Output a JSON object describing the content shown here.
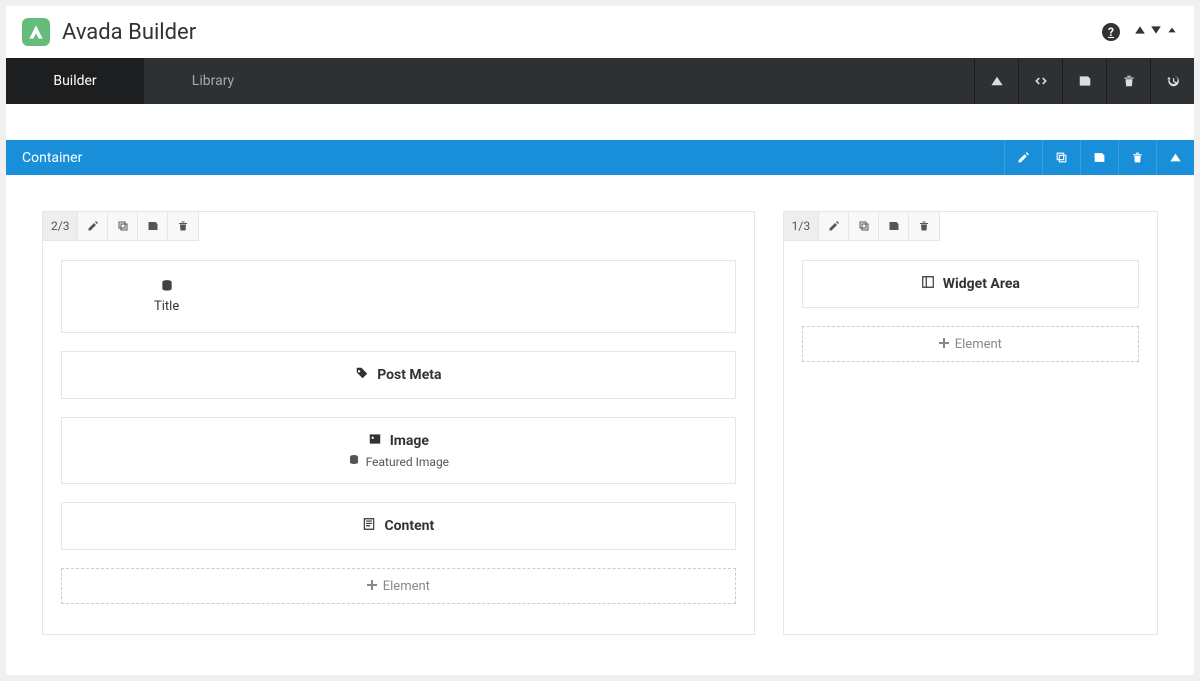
{
  "header": {
    "title": "Avada Builder"
  },
  "tabs": {
    "builder": "Builder",
    "library": "Library"
  },
  "container": {
    "title": "Container"
  },
  "columns": {
    "left": {
      "fraction": "2/3"
    },
    "right": {
      "fraction": "1/3"
    }
  },
  "elements": {
    "title": "Title",
    "post_meta": "Post Meta",
    "image": "Image",
    "featured_image": "Featured Image",
    "content": "Content",
    "widget_area": "Widget Area",
    "add": "Element"
  }
}
